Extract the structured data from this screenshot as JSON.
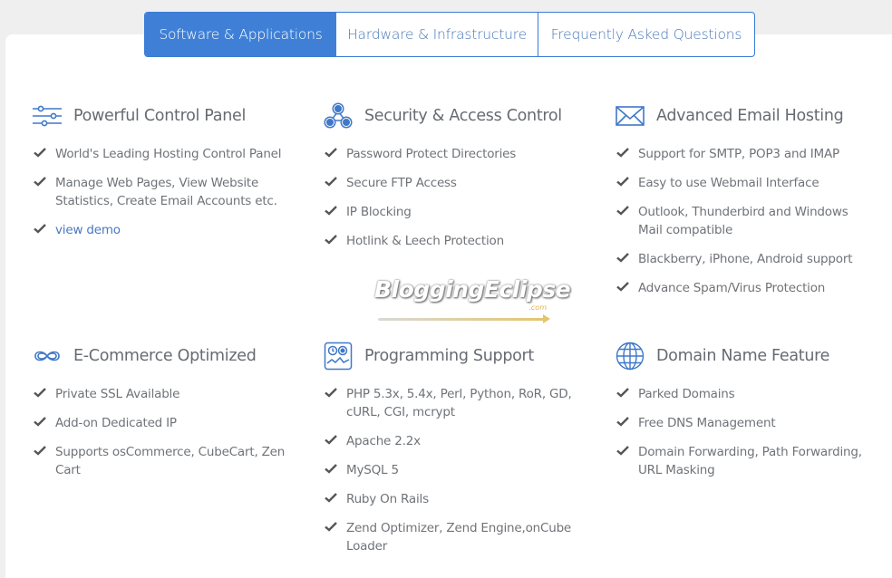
{
  "tabs": [
    {
      "label": "Software & Applications",
      "active": true
    },
    {
      "label": "Hardware & Infrastructure",
      "active": false
    },
    {
      "label": "Frequently Asked Questions",
      "active": false
    }
  ],
  "features": [
    {
      "icon": "sliders-icon",
      "title": "Powerful Control Panel",
      "items": [
        "World's Leading Hosting Control Panel",
        "Manage Web Pages, View Website Statistics, Create Email Accounts etc."
      ],
      "link": "view demo"
    },
    {
      "icon": "users-network-icon",
      "title": "Security & Access Control",
      "items": [
        "Password Protect Directories",
        "Secure FTP Access",
        "IP Blocking",
        "Hotlink & Leech Protection"
      ]
    },
    {
      "icon": "envelope-icon",
      "title": "Advanced Email Hosting",
      "items": [
        "Support for SMTP, POP3 and IMAP",
        "Easy to use Webmail Interface",
        "Outlook, Thunderbird and Windows Mail compatible",
        "Blackberry, iPhone, Android support",
        "Advance Spam/Virus Protection"
      ]
    },
    {
      "icon": "infinity-icon",
      "title": "E-Commerce Optimized",
      "items": [
        "Private SSL Available",
        "Add-on Dedicated IP",
        "Supports osCommerce, CubeCart, Zen Cart"
      ]
    },
    {
      "icon": "code-monitor-icon",
      "title": "Programming Support",
      "items": [
        "PHP 5.3x, 5.4x, Perl, Python, RoR, GD, cURL, CGI, mcrypt",
        "Apache 2.2x",
        "MySQL 5",
        "Ruby On Rails",
        "Zend Optimizer, Zend Engine,onCube Loader"
      ]
    },
    {
      "icon": "globe-icon",
      "title": "Domain Name Feature",
      "items": [
        "Parked Domains",
        "Free DNS Management",
        "Domain Forwarding, Path Forwarding, URL Masking"
      ]
    }
  ],
  "watermark": {
    "text": "BloggingEclipse",
    "suffix": ".com"
  },
  "colors": {
    "accent": "#3f80d6",
    "text": "#6f7378",
    "icon": "#3f78c8"
  }
}
